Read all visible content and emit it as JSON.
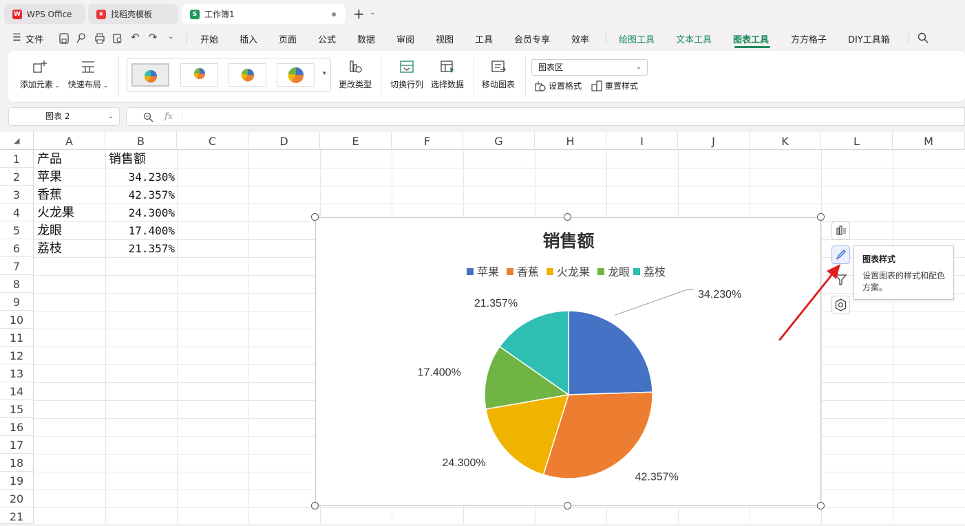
{
  "tabs": [
    {
      "label": "WPS Office",
      "icon": "wps-logo-icon",
      "active": false
    },
    {
      "label": "找稻壳模板",
      "icon": "docer-logo-icon",
      "active": false
    },
    {
      "label": "工作簿1",
      "icon": "spreadsheet-s-icon",
      "active": true
    }
  ],
  "menu": {
    "file": "文件",
    "items": [
      "开始",
      "插入",
      "页面",
      "公式",
      "数据",
      "审阅",
      "视图",
      "工具",
      "会员专享",
      "效率"
    ],
    "context_items": [
      "绘图工具",
      "文本工具",
      "图表工具"
    ],
    "extra_items": [
      "方方格子",
      "DIY工具箱"
    ],
    "active": "图表工具"
  },
  "ribbon": {
    "add_element": "添加元素",
    "quick_layout": "快速布局",
    "change_type": "更改类型",
    "switch_row_col": "切换行列",
    "select_data": "选择数据",
    "move_chart": "移动图表",
    "area_select": "图表区",
    "set_format": "设置格式",
    "reset_style": "重置样式"
  },
  "formula_bar": {
    "name_box": "图表 2",
    "fx": "fx"
  },
  "columns": [
    "A",
    "B",
    "C",
    "D",
    "E",
    "F",
    "G",
    "H",
    "I",
    "J",
    "K",
    "L",
    "M"
  ],
  "rows": [
    "1",
    "2",
    "3",
    "4",
    "5",
    "6",
    "7",
    "8",
    "9",
    "10",
    "11",
    "12",
    "13",
    "14",
    "15",
    "16",
    "17",
    "18",
    "19",
    "20",
    "21"
  ],
  "table": {
    "header": [
      "产品",
      "销售额"
    ],
    "rows": [
      [
        "苹果",
        "34.230%"
      ],
      [
        "香蕉",
        "42.357%"
      ],
      [
        "火龙果",
        "24.300%"
      ],
      [
        "龙眼",
        "17.400%"
      ],
      [
        "荔枝",
        "21.357%"
      ]
    ]
  },
  "chart_data": {
    "type": "pie",
    "title": "销售额",
    "categories": [
      "苹果",
      "香蕉",
      "火龙果",
      "龙眼",
      "荔枝"
    ],
    "values": [
      34.23,
      42.357,
      24.3,
      17.4,
      21.357
    ],
    "data_labels": [
      "34.230%",
      "42.357%",
      "24.300%",
      "17.400%",
      "21.357%"
    ],
    "colors": [
      "#4472c4",
      "#ed7d31",
      "#f0b400",
      "#70b443",
      "#2fbfb2"
    ],
    "legend_position": "top"
  },
  "chart_side_tools": [
    "chart-elements-icon",
    "chart-style-brush-icon",
    "chart-filter-icon",
    "chart-settings-icon"
  ],
  "tooltip": {
    "title": "图表样式",
    "description": "设置图表的样式和配色方案。"
  },
  "accent_color": "#1a8c5c"
}
